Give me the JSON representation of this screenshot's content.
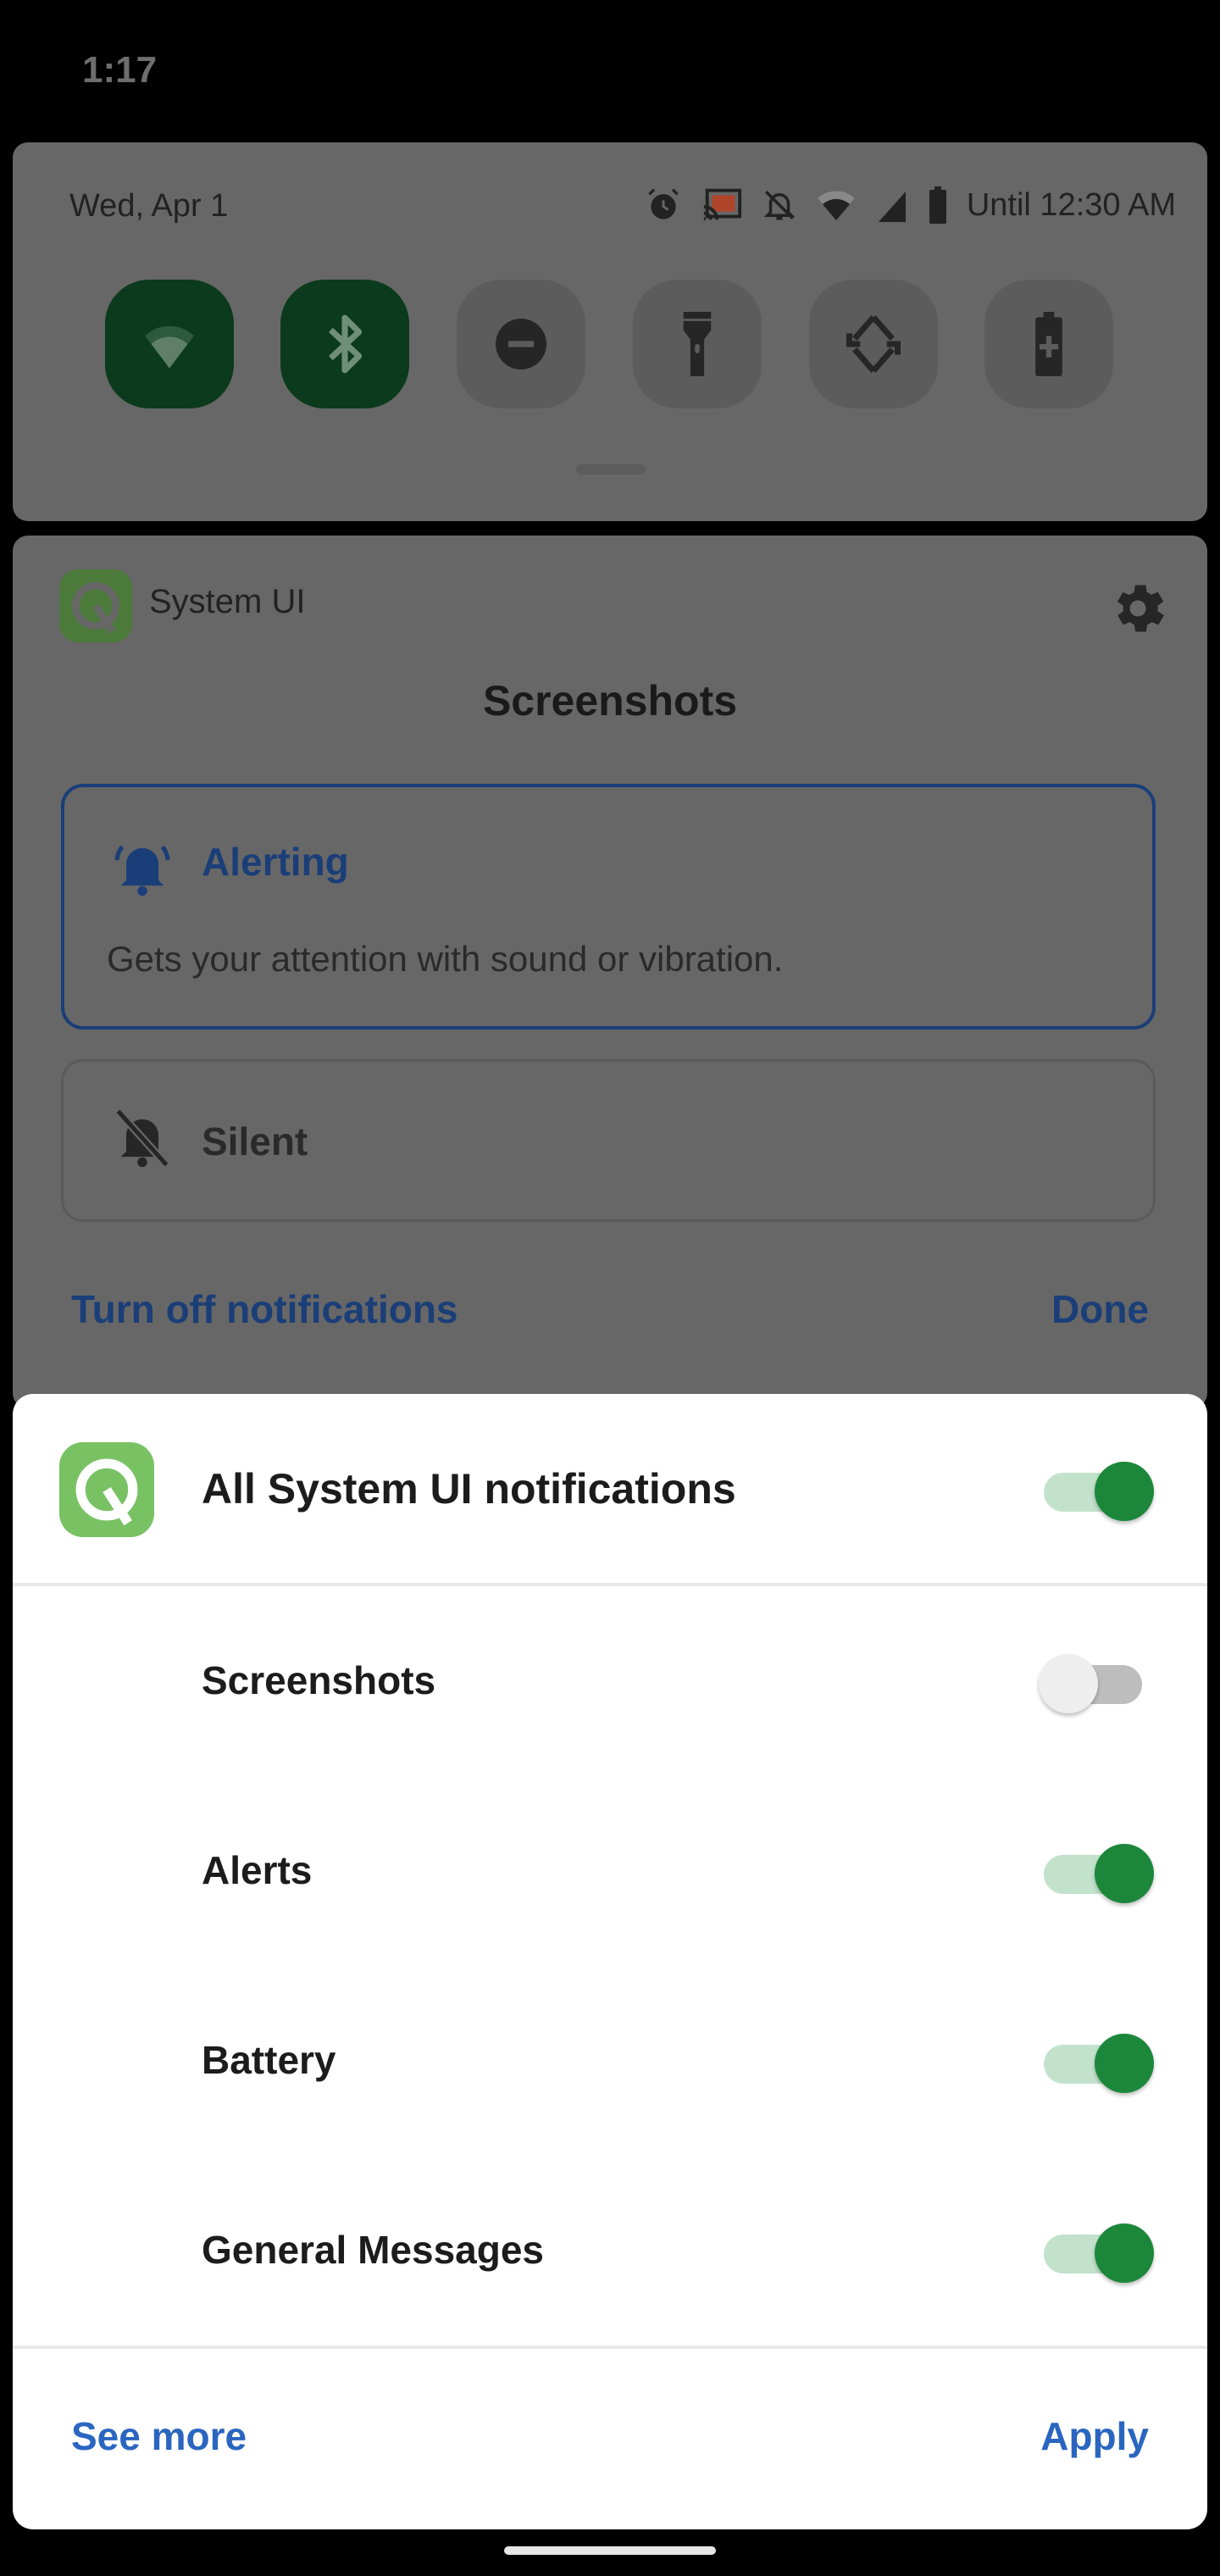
{
  "status_bar": {
    "time": "1:17"
  },
  "quick_settings": {
    "date": "Wed, Apr 1",
    "status_icons": [
      "alarm-icon",
      "cast-icon",
      "notifications-off-icon",
      "wifi-icon",
      "cellular-signal-icon",
      "battery-icon"
    ],
    "dnd_until": "Until 12:30 AM",
    "tiles": [
      {
        "name": "wifi",
        "icon": "wifi-icon",
        "active": true
      },
      {
        "name": "bluetooth",
        "icon": "bluetooth-icon",
        "active": true
      },
      {
        "name": "do-not-disturb",
        "icon": "do-not-disturb-icon",
        "active": false
      },
      {
        "name": "flashlight",
        "icon": "flashlight-icon",
        "active": false
      },
      {
        "name": "auto-rotate",
        "icon": "rotate-icon",
        "active": false
      },
      {
        "name": "battery-saver",
        "icon": "battery-saver-icon",
        "active": false
      }
    ],
    "colors": {
      "active_tile": "#0b3a1c",
      "inactive_tile": "#5c5c5c"
    }
  },
  "notification_settings": {
    "app_name": "System UI",
    "channel_title": "Screenshots",
    "options": {
      "alerting": {
        "label": "Alerting",
        "description": "Gets your attention with sound or vibration.",
        "selected": true
      },
      "silent": {
        "label": "Silent",
        "selected": false
      }
    },
    "turn_off_label": "Turn off notifications",
    "done_label": "Done",
    "accent_color": "#1a3e78"
  },
  "sheet": {
    "all_label": "All System UI notifications",
    "all_enabled": true,
    "channels": [
      {
        "label": "Screenshots",
        "enabled": false
      },
      {
        "label": "Alerts",
        "enabled": true
      },
      {
        "label": "Battery",
        "enabled": true
      },
      {
        "label": "General Messages",
        "enabled": true
      }
    ],
    "see_more_label": "See more",
    "apply_label": "Apply",
    "switch_on_color": "#1c873b",
    "link_color": "#2a66c0"
  }
}
